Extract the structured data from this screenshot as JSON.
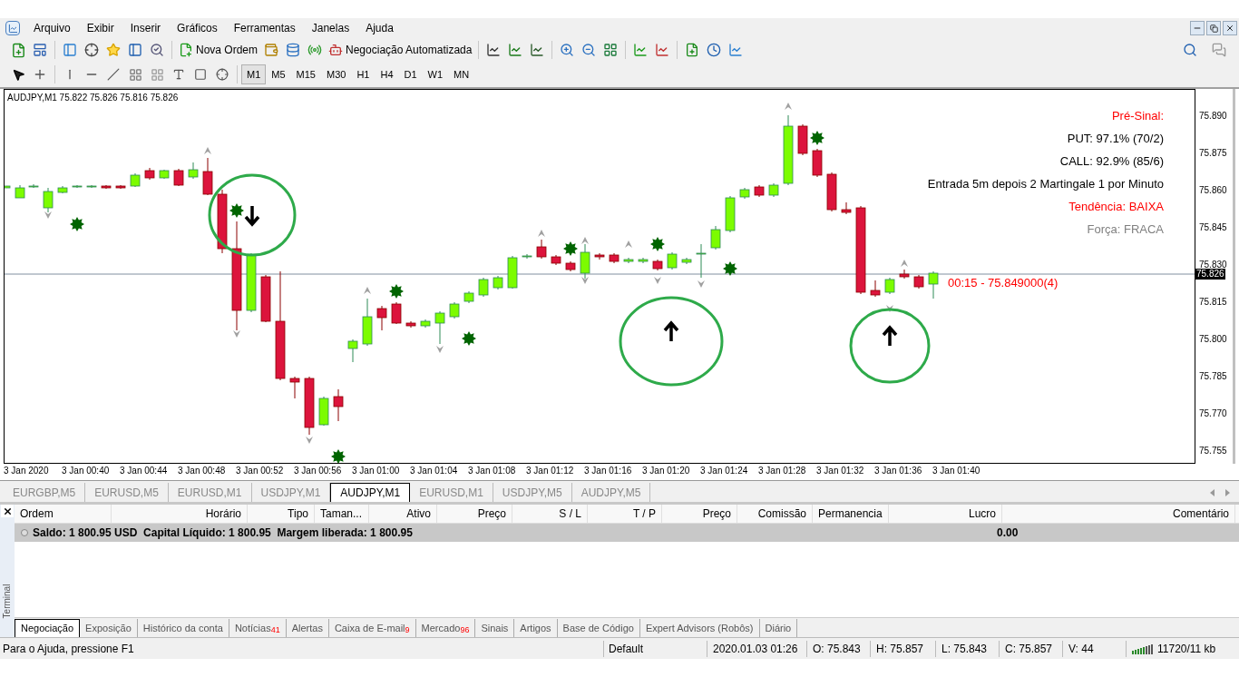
{
  "menu": [
    "Arquivo",
    "Exibir",
    "Inserir",
    "Gráficos",
    "Ferramentas",
    "Janelas",
    "Ajuda"
  ],
  "toolbar": {
    "new_order": "Nova Ordem",
    "auto_trading": "Negociação Automatizada"
  },
  "timeframes": [
    {
      "label": "M1",
      "selected": true
    },
    {
      "label": "M5",
      "selected": false
    },
    {
      "label": "M15",
      "selected": false
    },
    {
      "label": "M30",
      "selected": false
    },
    {
      "label": "H1",
      "selected": false
    },
    {
      "label": "H4",
      "selected": false
    },
    {
      "label": "D1",
      "selected": false
    },
    {
      "label": "W1",
      "selected": false
    },
    {
      "label": "MN",
      "selected": false
    }
  ],
  "chart": {
    "title": "AUDJPY,M1  75.822 75.826 75.816 75.826",
    "info_lines": [
      {
        "text": "Pré-Sinal:",
        "color": "#ff0000"
      },
      {
        "text": "PUT: 97.1% (70/2)",
        "color": "#000000"
      },
      {
        "text": "CALL: 92.9% (85/6)",
        "color": "#000000"
      },
      {
        "text": "Entrada 5m depois 2 Martingale 1 por Minuto",
        "color": "#000000"
      },
      {
        "text": "Tendência: BAIXA",
        "color": "#ff0000"
      },
      {
        "text": "Força: FRACA",
        "color": "#808080"
      }
    ],
    "countdown": "00:15 - 75.849000(4)",
    "price_labels": [
      "75.890",
      "75.875",
      "75.860",
      "75.845",
      "75.830",
      "75.815",
      "75.800",
      "75.785",
      "75.770",
      "75.755"
    ],
    "current_price": "75.826",
    "time_labels": [
      "3 Jan 2020",
      "3 Jan 00:40",
      "3 Jan 00:44",
      "3 Jan 00:48",
      "3 Jan 00:52",
      "3 Jan 00:56",
      "3 Jan 01:00",
      "3 Jan 01:04",
      "3 Jan 01:08",
      "3 Jan 01:12",
      "3 Jan 01:16",
      "3 Jan 01:20",
      "3 Jan 01:24",
      "3 Jan 01:28",
      "3 Jan 01:32",
      "3 Jan 01:36",
      "3 Jan 01:40"
    ]
  },
  "chart_tabs": [
    {
      "label": "EURGBP,M5",
      "selected": false
    },
    {
      "label": "EURUSD,M5",
      "selected": false
    },
    {
      "label": "EURUSD,M1",
      "selected": false
    },
    {
      "label": "USDJPY,M1",
      "selected": false
    },
    {
      "label": "AUDJPY,M1",
      "selected": true
    },
    {
      "label": "EURUSD,M1",
      "selected": false
    },
    {
      "label": "USDJPY,M5",
      "selected": false
    },
    {
      "label": "AUDJPY,M5",
      "selected": false
    }
  ],
  "terminal": {
    "title": "Terminal",
    "columns": [
      "Ordem",
      "Horário",
      "Tipo",
      "Taman...",
      "Ativo",
      "Preço",
      "S / L",
      "T / P",
      "Preço",
      "Comissão",
      "Permanencia",
      "Lucro",
      "Comentário"
    ],
    "summary": "Saldo: 1 800.95 USD  Capital Líquido: 1 800.95  Margem liberada: 1 800.95",
    "profit": "0.00",
    "tabs": [
      {
        "label": "Negociação",
        "selected": true
      },
      {
        "label": "Exposição",
        "selected": false
      },
      {
        "label": "Histórico da conta",
        "selected": false
      },
      {
        "label": "Notícias",
        "badge": "41",
        "selected": false
      },
      {
        "label": "Alertas",
        "selected": false
      },
      {
        "label": "Caixa de E-mail",
        "badge": "9",
        "selected": false
      },
      {
        "label": "Mercado",
        "badge": "96",
        "selected": false
      },
      {
        "label": "Sinais",
        "selected": false
      },
      {
        "label": "Artigos",
        "selected": false
      },
      {
        "label": "Base de Código",
        "selected": false
      },
      {
        "label": "Expert Advisors (Robôs)",
        "selected": false
      },
      {
        "label": "Diário",
        "selected": false
      }
    ]
  },
  "status_bar": {
    "help": "Para o Ajuda, pressione F1",
    "profile": "Default",
    "time": "2020.01.03 01:26",
    "open": "O: 75.843",
    "high": "H: 75.857",
    "low": "L: 75.843",
    "close": "C: 75.857",
    "volume": "V: 44",
    "traffic": "11720/11 kb"
  }
}
